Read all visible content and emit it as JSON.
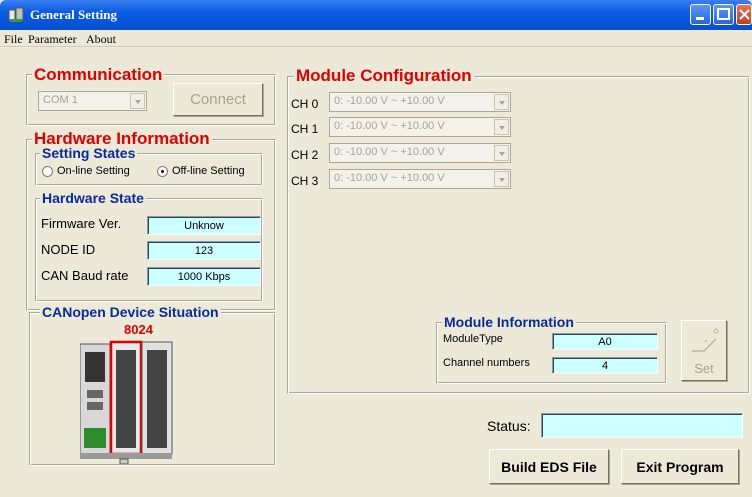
{
  "window": {
    "title": "General Setting"
  },
  "menu": [
    "File",
    "Parameter",
    "About"
  ],
  "communication": {
    "title": "Communication",
    "port_value": "COM 1",
    "connect_label": "Connect"
  },
  "hardware_info": {
    "title": "Hardware Information",
    "setting_states": {
      "title": "Setting States",
      "online_label": "On-line Setting",
      "offline_label": "Off-line Setting",
      "selected": "offline"
    },
    "hardware_state": {
      "title": "Hardware State",
      "firmware_label": "Firmware Ver.",
      "firmware_value": "Unknow",
      "node_label": "NODE ID",
      "node_value": "123",
      "baud_label": "CAN Baud rate",
      "baud_value": "1000  Kbps"
    }
  },
  "device_situation": {
    "title": "CANopen Device Situation",
    "model": "8024"
  },
  "module_config": {
    "title": "Module Configuration",
    "channels": [
      {
        "label": "CH 0",
        "value": "0: -10.00  V ~ +10.00  V"
      },
      {
        "label": "CH 1",
        "value": "0: -10.00  V ~ +10.00  V"
      },
      {
        "label": "CH 2",
        "value": "0: -10.00  V ~ +10.00  V"
      },
      {
        "label": "CH 3",
        "value": "0: -10.00  V ~ +10.00  V"
      }
    ]
  },
  "module_info": {
    "title": "Module Information",
    "type_label": "ModuleType",
    "type_value": "A0",
    "channels_label": "Channel numbers",
    "channels_value": "4",
    "set_label": "Set"
  },
  "status": {
    "label": "Status:",
    "value": ""
  },
  "buttons": {
    "build_eds": "Build EDS File",
    "exit": "Exit Program"
  }
}
